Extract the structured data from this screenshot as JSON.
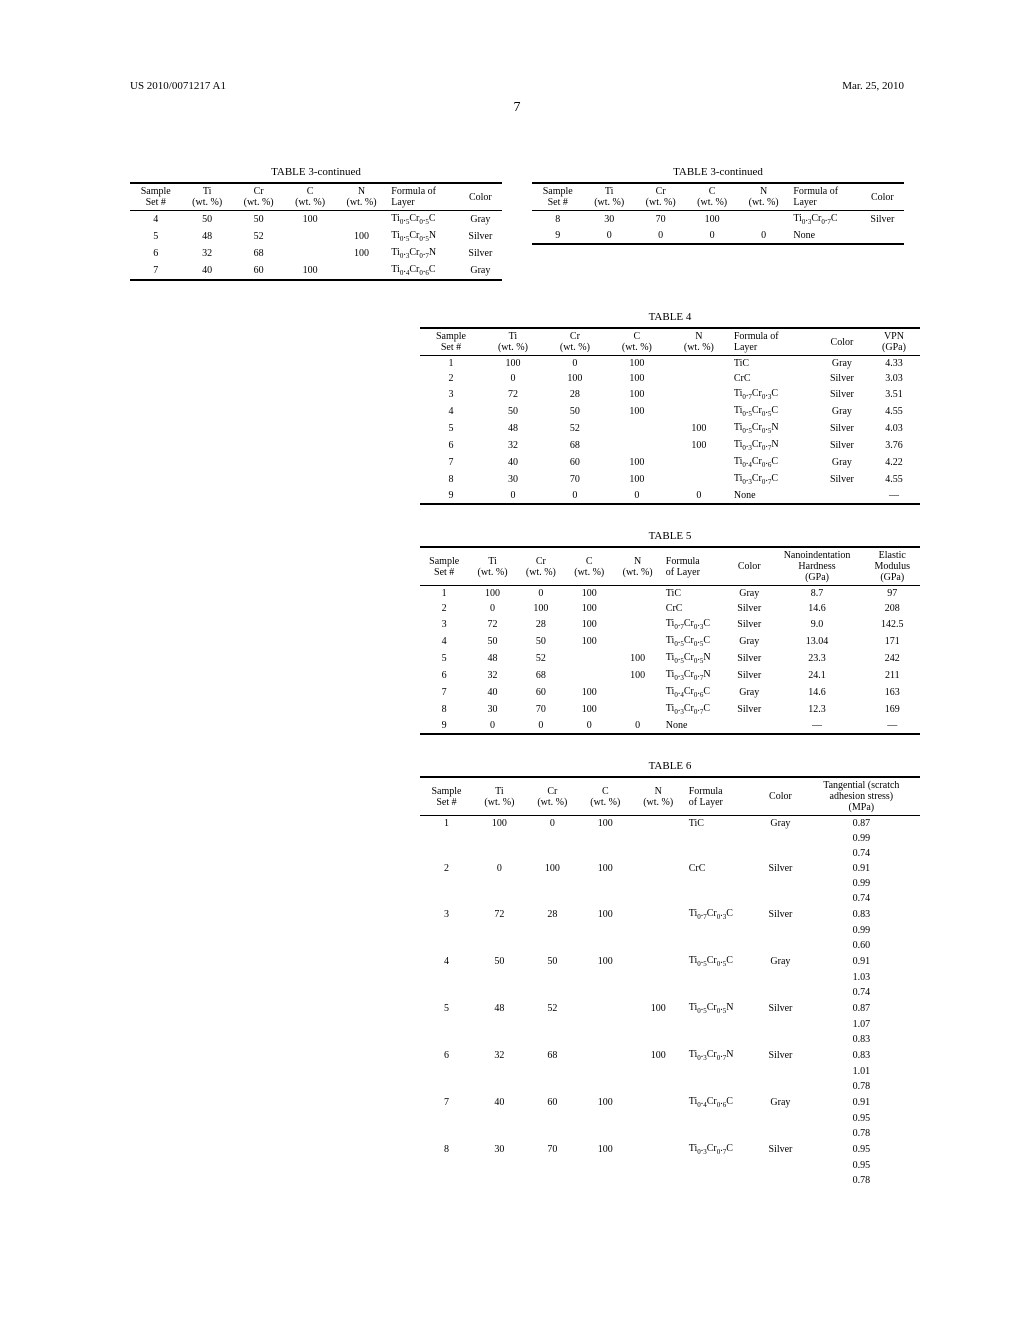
{
  "header": {
    "pub_number": "US 2010/0071217 A1",
    "pub_date": "Mar. 25, 2010",
    "page": "7"
  },
  "table3_left": {
    "title": "TABLE 3-continued",
    "headers": [
      "Sample Set #",
      "Ti (wt. %)",
      "Cr (wt. %)",
      "C (wt. %)",
      "N (wt. %)",
      "Formula of Layer",
      "Color"
    ],
    "rows": [
      {
        "n": "4",
        "ti": "50",
        "cr": "50",
        "c": "100",
        "nn": "",
        "f": "Ti₀.₅Cr₀.₅C",
        "col": "Gray"
      },
      {
        "n": "5",
        "ti": "48",
        "cr": "52",
        "c": "",
        "nn": "100",
        "f": "Ti₀.₅Cr₀.₅N",
        "col": "Silver"
      },
      {
        "n": "6",
        "ti": "32",
        "cr": "68",
        "c": "",
        "nn": "100",
        "f": "Ti₀.₃Cr₀.₇N",
        "col": "Silver"
      },
      {
        "n": "7",
        "ti": "40",
        "cr": "60",
        "c": "100",
        "nn": "",
        "f": "Ti₀.₄Cr₀.₆C",
        "col": "Gray"
      }
    ]
  },
  "table3_right": {
    "title": "TABLE 3-continued",
    "headers": [
      "Sample Set #",
      "Ti (wt. %)",
      "Cr (wt. %)",
      "C (wt. %)",
      "N (wt. %)",
      "Formula of Layer",
      "Color"
    ],
    "rows": [
      {
        "n": "8",
        "ti": "30",
        "cr": "70",
        "c": "100",
        "nn": "",
        "f": "Ti₀.₃Cr₀.₇C",
        "col": "Silver"
      },
      {
        "n": "9",
        "ti": "0",
        "cr": "0",
        "c": "0",
        "nn": "0",
        "f": "None",
        "col": ""
      }
    ]
  },
  "table4": {
    "title": "TABLE 4",
    "headers": [
      "Sample Set #",
      "Ti (wt. %)",
      "Cr (wt. %)",
      "C (wt. %)",
      "N (wt. %)",
      "Formula of Layer",
      "Color",
      "VPN (GPa)"
    ],
    "rows": [
      {
        "n": "1",
        "ti": "100",
        "cr": "0",
        "c": "100",
        "nn": "",
        "f": "TiC",
        "col": "Gray",
        "v": "4.33"
      },
      {
        "n": "2",
        "ti": "0",
        "cr": "100",
        "c": "100",
        "nn": "",
        "f": "CrC",
        "col": "Silver",
        "v": "3.03"
      },
      {
        "n": "3",
        "ti": "72",
        "cr": "28",
        "c": "100",
        "nn": "",
        "f": "Ti₀.₇Cr₀.₃C",
        "col": "Silver",
        "v": "3.51"
      },
      {
        "n": "4",
        "ti": "50",
        "cr": "50",
        "c": "100",
        "nn": "",
        "f": "Ti₀.₅Cr₀.₅C",
        "col": "Gray",
        "v": "4.55"
      },
      {
        "n": "5",
        "ti": "48",
        "cr": "52",
        "c": "",
        "nn": "100",
        "f": "Ti₀.₅Cr₀.₅N",
        "col": "Silver",
        "v": "4.03"
      },
      {
        "n": "6",
        "ti": "32",
        "cr": "68",
        "c": "",
        "nn": "100",
        "f": "Ti₀.₃Cr₀.₇N",
        "col": "Silver",
        "v": "3.76"
      },
      {
        "n": "7",
        "ti": "40",
        "cr": "60",
        "c": "100",
        "nn": "",
        "f": "Ti₀.₄Cr₀.₆C",
        "col": "Gray",
        "v": "4.22"
      },
      {
        "n": "8",
        "ti": "30",
        "cr": "70",
        "c": "100",
        "nn": "",
        "f": "Ti₀.₃Cr₀.₇C",
        "col": "Silver",
        "v": "4.55"
      },
      {
        "n": "9",
        "ti": "0",
        "cr": "0",
        "c": "0",
        "nn": "0",
        "f": "None",
        "col": "",
        "v": "—"
      }
    ]
  },
  "table5": {
    "title": "TABLE 5",
    "headers": [
      "Sample Set #",
      "Ti (wt. %)",
      "Cr (wt. %)",
      "C (wt. %)",
      "N (wt. %)",
      "Formula of Layer",
      "Color",
      "Nanoindentation Hardness (GPa)",
      "Elastic Modulus (GPa)"
    ],
    "rows": [
      {
        "n": "1",
        "ti": "100",
        "cr": "0",
        "c": "100",
        "nn": "",
        "f": "TiC",
        "col": "Gray",
        "h": "8.7",
        "e": "97"
      },
      {
        "n": "2",
        "ti": "0",
        "cr": "100",
        "c": "100",
        "nn": "",
        "f": "CrC",
        "col": "Silver",
        "h": "14.6",
        "e": "208"
      },
      {
        "n": "3",
        "ti": "72",
        "cr": "28",
        "c": "100",
        "nn": "",
        "f": "Ti₀.₇Cr₀.₃C",
        "col": "Silver",
        "h": "9.0",
        "e": "142.5"
      },
      {
        "n": "4",
        "ti": "50",
        "cr": "50",
        "c": "100",
        "nn": "",
        "f": "Ti₀.₅Cr₀.₅C",
        "col": "Gray",
        "h": "13.04",
        "e": "171"
      },
      {
        "n": "5",
        "ti": "48",
        "cr": "52",
        "c": "",
        "nn": "100",
        "f": "Ti₀.₅Cr₀.₅N",
        "col": "Silver",
        "h": "23.3",
        "e": "242"
      },
      {
        "n": "6",
        "ti": "32",
        "cr": "68",
        "c": "",
        "nn": "100",
        "f": "Ti₀.₃Cr₀.₇N",
        "col": "Silver",
        "h": "24.1",
        "e": "211"
      },
      {
        "n": "7",
        "ti": "40",
        "cr": "60",
        "c": "100",
        "nn": "",
        "f": "Ti₀.₄Cr₀.₆C",
        "col": "Gray",
        "h": "14.6",
        "e": "163"
      },
      {
        "n": "8",
        "ti": "30",
        "cr": "70",
        "c": "100",
        "nn": "",
        "f": "Ti₀.₃Cr₀.₇C",
        "col": "Silver",
        "h": "12.3",
        "e": "169"
      },
      {
        "n": "9",
        "ti": "0",
        "cr": "0",
        "c": "0",
        "nn": "0",
        "f": "None",
        "col": "",
        "h": "—",
        "e": "—"
      }
    ]
  },
  "table6": {
    "title": "TABLE 6",
    "headers": [
      "Sample Set #",
      "Ti (wt. %)",
      "Cr (wt. %)",
      "C (wt. %)",
      "N (wt. %)",
      "Formula of Layer",
      "Color",
      "Tangential (scratch adhesion stress) (MPa)"
    ],
    "rows": [
      {
        "n": "1",
        "ti": "100",
        "cr": "0",
        "c": "100",
        "nn": "",
        "f": "TiC",
        "col": "Gray",
        "t": [
          "0.87",
          "0.99",
          "0.74"
        ]
      },
      {
        "n": "2",
        "ti": "0",
        "cr": "100",
        "c": "100",
        "nn": "",
        "f": "CrC",
        "col": "Silver",
        "t": [
          "0.91",
          "0.99",
          "0.74"
        ]
      },
      {
        "n": "3",
        "ti": "72",
        "cr": "28",
        "c": "100",
        "nn": "",
        "f": "Ti₀.₇Cr₀.₃C",
        "col": "Silver",
        "t": [
          "0.83",
          "0.99",
          "0.60"
        ]
      },
      {
        "n": "4",
        "ti": "50",
        "cr": "50",
        "c": "100",
        "nn": "",
        "f": "Ti₀.₅Cr₀.₅C",
        "col": "Gray",
        "t": [
          "0.91",
          "1.03",
          "0.74"
        ]
      },
      {
        "n": "5",
        "ti": "48",
        "cr": "52",
        "c": "",
        "nn": "100",
        "f": "Ti₀.₅Cr₀.₅N",
        "col": "Silver",
        "t": [
          "0.87",
          "1.07",
          "0.83"
        ]
      },
      {
        "n": "6",
        "ti": "32",
        "cr": "68",
        "c": "",
        "nn": "100",
        "f": "Ti₀.₃Cr₀.₇N",
        "col": "Silver",
        "t": [
          "0.83",
          "1.01",
          "0.78"
        ]
      },
      {
        "n": "7",
        "ti": "40",
        "cr": "60",
        "c": "100",
        "nn": "",
        "f": "Ti₀.₄Cr₀.₆C",
        "col": "Gray",
        "t": [
          "0.91",
          "0.95",
          "0.78"
        ]
      },
      {
        "n": "8",
        "ti": "30",
        "cr": "70",
        "c": "100",
        "nn": "",
        "f": "Ti₀.₃Cr₀.₇C",
        "col": "Silver",
        "t": [
          "0.95",
          "0.95",
          "0.78"
        ]
      }
    ]
  }
}
